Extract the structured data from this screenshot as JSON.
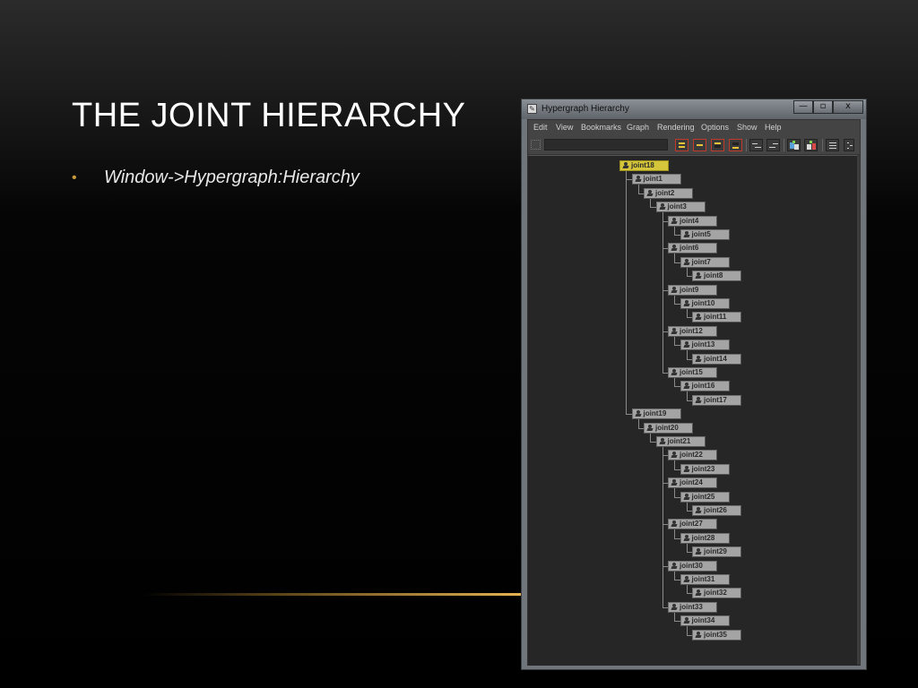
{
  "slide": {
    "title": "THE JOINT HIERARCHY",
    "bullet": "Window->Hypergraph:Hierarchy",
    "bullet_symbol": "•",
    "accent_color": "#c79a3a"
  },
  "window": {
    "title": "Hypergraph Hierarchy",
    "controls": {
      "minimize": "—",
      "maximize": "▫",
      "close": "x"
    }
  },
  "menu": [
    "Edit",
    "View",
    "Bookmarks",
    "Graph",
    "Rendering",
    "Options",
    "Show",
    "Help"
  ],
  "toolbar": {
    "icons": [
      "scene-hierarchy-icon",
      "input-output-connections-icon",
      "previous-view-icon",
      "next-view-icon",
      "frame-all-icon",
      "frame-selection-icon",
      "toggle-swatches-icon",
      "refresh-swatches-icon",
      "list-view-icon",
      "options-icon"
    ]
  },
  "hierarchy": [
    {
      "label": "joint18",
      "depth": 0,
      "selected": true
    },
    {
      "label": "joint1",
      "depth": 1
    },
    {
      "label": "joint2",
      "depth": 2
    },
    {
      "label": "joint3",
      "depth": 3
    },
    {
      "label": "joint4",
      "depth": 4
    },
    {
      "label": "joint5",
      "depth": 5
    },
    {
      "label": "joint6",
      "depth": 4
    },
    {
      "label": "joint7",
      "depth": 5
    },
    {
      "label": "joint8",
      "depth": 6
    },
    {
      "label": "joint9",
      "depth": 4
    },
    {
      "label": "joint10",
      "depth": 5
    },
    {
      "label": "joint11",
      "depth": 6
    },
    {
      "label": "joint12",
      "depth": 4
    },
    {
      "label": "joint13",
      "depth": 5
    },
    {
      "label": "joint14",
      "depth": 6
    },
    {
      "label": "joint15",
      "depth": 4
    },
    {
      "label": "joint16",
      "depth": 5
    },
    {
      "label": "joint17",
      "depth": 6
    },
    {
      "label": "joint19",
      "depth": 1
    },
    {
      "label": "joint20",
      "depth": 2
    },
    {
      "label": "joint21",
      "depth": 3
    },
    {
      "label": "joint22",
      "depth": 4
    },
    {
      "label": "joint23",
      "depth": 5
    },
    {
      "label": "joint24",
      "depth": 4
    },
    {
      "label": "joint25",
      "depth": 5
    },
    {
      "label": "joint26",
      "depth": 6
    },
    {
      "label": "joint27",
      "depth": 4
    },
    {
      "label": "joint28",
      "depth": 5
    },
    {
      "label": "joint29",
      "depth": 6
    },
    {
      "label": "joint30",
      "depth": 4
    },
    {
      "label": "joint31",
      "depth": 5
    },
    {
      "label": "joint32",
      "depth": 6
    },
    {
      "label": "joint33",
      "depth": 4
    },
    {
      "label": "joint34",
      "depth": 5
    },
    {
      "label": "joint35",
      "depth": 6
    }
  ]
}
